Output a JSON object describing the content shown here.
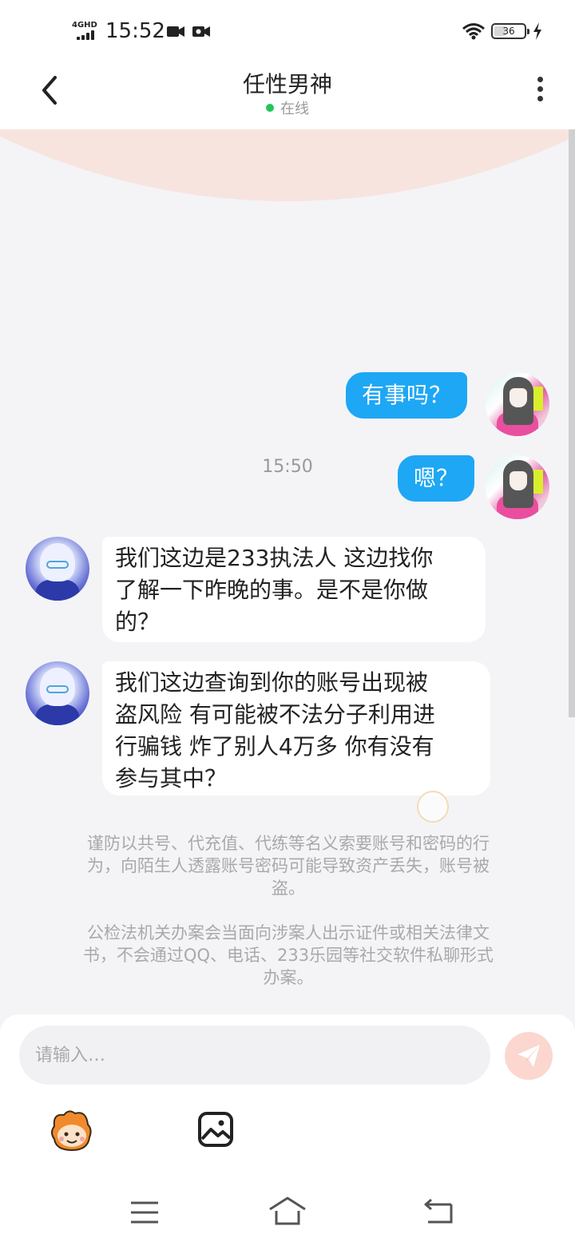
{
  "status_bar": {
    "network": "4GHD",
    "time": "15:52",
    "battery": "36"
  },
  "header": {
    "title": "任性男神",
    "status": "在线"
  },
  "chat": {
    "timestamp": "15:50",
    "messages": [
      {
        "from": "me",
        "text": "有事吗？"
      },
      {
        "from": "me",
        "text": "嗯？"
      },
      {
        "from": "them",
        "lines": [
          "我们这边是233执法人 这边找你",
          "了解一下昨晚的事。是不是你做",
          "的？"
        ]
      },
      {
        "from": "them",
        "lines": [
          "我们这边查询到你的账号出现被",
          "盗风险 有可能被不法分子利用进",
          "行骗钱 炸了别人4万多 你有没有",
          "参与其中？"
        ]
      }
    ],
    "notices": [
      {
        "lines": [
          "谨防以共号、代充值、代练等名义索要账号和密码的行",
          "为，向陌生人透露账号密码可能导致资产丢失，账号被",
          "盗。"
        ]
      },
      {
        "lines": [
          "公检法机关办案会当面向涉案人出示证件或相关法律文",
          "书，不会通过QQ、电话、233乐园等社交软件私聊形式",
          "办案。"
        ]
      }
    ]
  },
  "input": {
    "placeholder": "请输入…"
  },
  "colors": {
    "my_bubble": "#1ea7f5",
    "their_bubble": "#ffffff",
    "online_dot": "#21c65a",
    "header_arc": "#f8e4df",
    "send_button": "#fbd7d0"
  },
  "icons": {
    "back": "chevron-left-icon",
    "more": "more-vertical-icon",
    "send": "paper-plane-icon",
    "emoji": "emoji-mascot-icon",
    "image": "image-icon"
  }
}
